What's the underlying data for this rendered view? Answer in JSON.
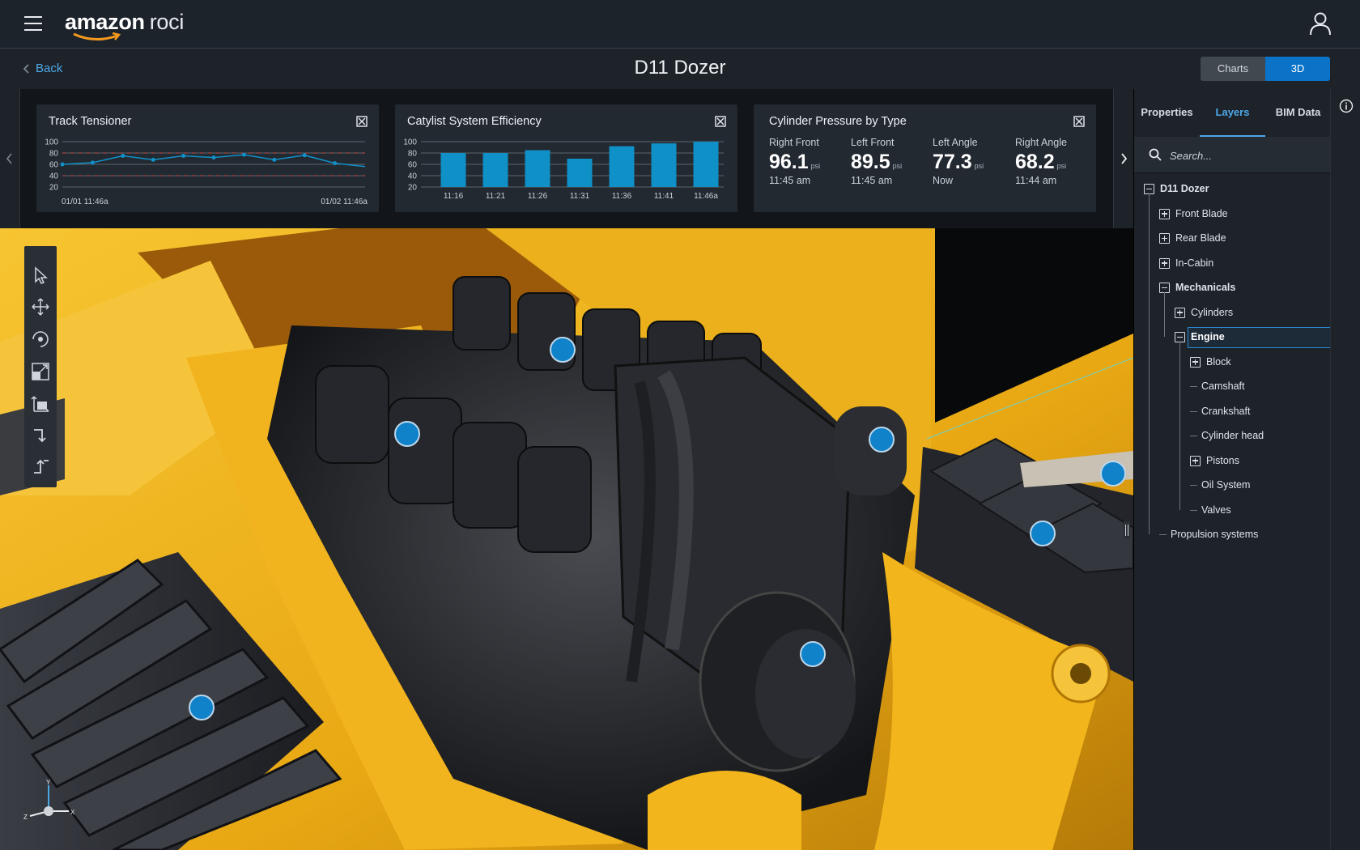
{
  "app": {
    "logo_brand": "amazon",
    "logo_product": "roci"
  },
  "header": {
    "back_label": "Back",
    "title": "D11 Dozer",
    "view_charts": "Charts",
    "view_3d": "3D view"
  },
  "icons": {
    "menu": "hamburger-menu-icon",
    "user": "user-profile-icon",
    "info": "info-icon",
    "expand": "expand-icon",
    "search": "search-icon"
  },
  "colors": {
    "accent": "#0a73c7",
    "link": "#4da8e6",
    "series": "#0f90c7",
    "dozer_yellow": "#f2b51a"
  },
  "cards": {
    "track": {
      "title": "Track Tensioner",
      "x_labels": [
        "01/01 11:46a",
        "01/02 11:46a"
      ]
    },
    "efficiency": {
      "title": "Catylist System Efficiency"
    },
    "pressure": {
      "title": "Cylinder Pressure by Type",
      "unit": "psi",
      "items": [
        {
          "label": "Right Front",
          "value": "96.1",
          "time": "11:45 am"
        },
        {
          "label": "Left Front",
          "value": "89.5",
          "time": "11:45 am"
        },
        {
          "label": "Left Angle",
          "value": "77.3",
          "time": "Now"
        },
        {
          "label": "Right Angle",
          "value": "68.2",
          "time": "11:44 am"
        }
      ]
    }
  },
  "chart_data": [
    {
      "type": "line",
      "title": "Track Tensioner",
      "x_labels": [
        "01/01 11:46a",
        "01/02 11:46a"
      ],
      "ylim": [
        20,
        100
      ],
      "yticks": [
        100,
        80,
        60,
        40,
        20
      ],
      "series": [
        {
          "values": [
            60,
            63,
            75,
            68,
            75,
            72,
            77,
            68,
            76,
            62,
            56
          ]
        }
      ],
      "thresholds": [
        40,
        80
      ]
    },
    {
      "type": "bar",
      "title": "Catylist System Efficiency",
      "categories": [
        "11:16",
        "11:21",
        "11:26",
        "11:31",
        "11:36",
        "11:41",
        "11:46a"
      ],
      "values": [
        80,
        80,
        85,
        70,
        92,
        97,
        100
      ],
      "ylim": [
        20,
        100
      ],
      "yticks": [
        100,
        80,
        60,
        40,
        20
      ]
    }
  ],
  "panel": {
    "tabs": [
      "Properties",
      "Layers",
      "BIM Data"
    ],
    "active_tab": "Layers",
    "search_placeholder": "Search...",
    "tree": [
      {
        "label": "D11 Dozer",
        "depth": 0,
        "toggle": "minus",
        "bold": true
      },
      {
        "label": "Front Blade",
        "depth": 1,
        "toggle": "plus"
      },
      {
        "label": "Rear Blade",
        "depth": 1,
        "toggle": "plus"
      },
      {
        "label": "In-Cabin",
        "depth": 1,
        "toggle": "plus"
      },
      {
        "label": "Mechanicals",
        "depth": 1,
        "toggle": "minus",
        "bold": true
      },
      {
        "label": "Cylinders",
        "depth": 2,
        "toggle": "plus"
      },
      {
        "label": "Engine",
        "depth": 2,
        "toggle": "minus",
        "bold": true,
        "selected": true
      },
      {
        "label": "Block",
        "depth": 3,
        "toggle": "plus"
      },
      {
        "label": "Camshaft",
        "depth": 3,
        "toggle": "none"
      },
      {
        "label": "Crankshaft",
        "depth": 3,
        "toggle": "none"
      },
      {
        "label": "Cylinder head",
        "depth": 3,
        "toggle": "none"
      },
      {
        "label": "Pistons",
        "depth": 3,
        "toggle": "plus"
      },
      {
        "label": "Oil System",
        "depth": 3,
        "toggle": "none"
      },
      {
        "label": "Valves",
        "depth": 3,
        "toggle": "none"
      },
      {
        "label": "Propulsion systems",
        "depth": 1,
        "toggle": "none"
      }
    ]
  },
  "viewport": {
    "axis_labels": [
      "Y",
      "Z",
      "X"
    ],
    "tools": [
      "select-tool",
      "pan-tool",
      "orbit-tool",
      "zoom-extents-tool",
      "scale-tool",
      "step-down-tool",
      "step-up-tool"
    ]
  }
}
